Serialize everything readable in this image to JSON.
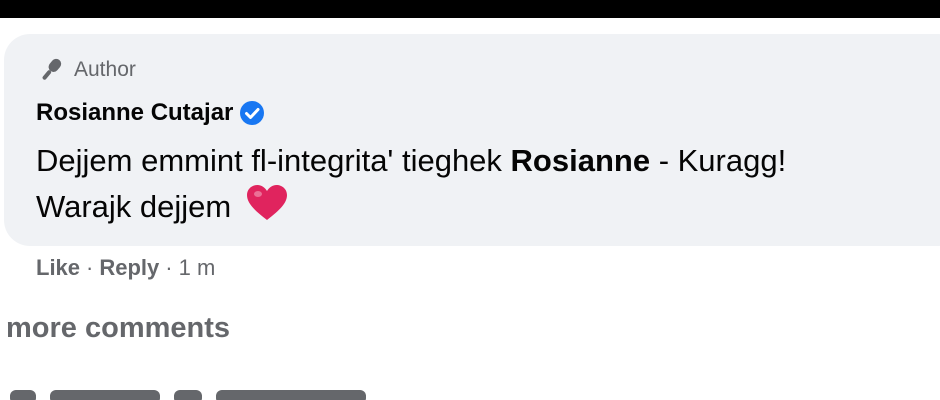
{
  "comment": {
    "badge_label": "Author",
    "author_name": "Rosianne Cutajar",
    "text_part1": "Dejjem emmint fl-integrita' tieghek ",
    "text_bold": "Rosianne",
    "text_part2": " - Kuragg!",
    "text_line2": "Warajk dejjem",
    "emoji": "red-heart"
  },
  "actions": {
    "like_label": "Like",
    "reply_label": "Reply",
    "timestamp": "1 m"
  },
  "footer": {
    "more_comments_label": "more comments"
  },
  "colors": {
    "bubble": "#f0f2f5",
    "secondary_text": "#65676b",
    "verified": "#1877f2",
    "heart": "#e0245e"
  }
}
